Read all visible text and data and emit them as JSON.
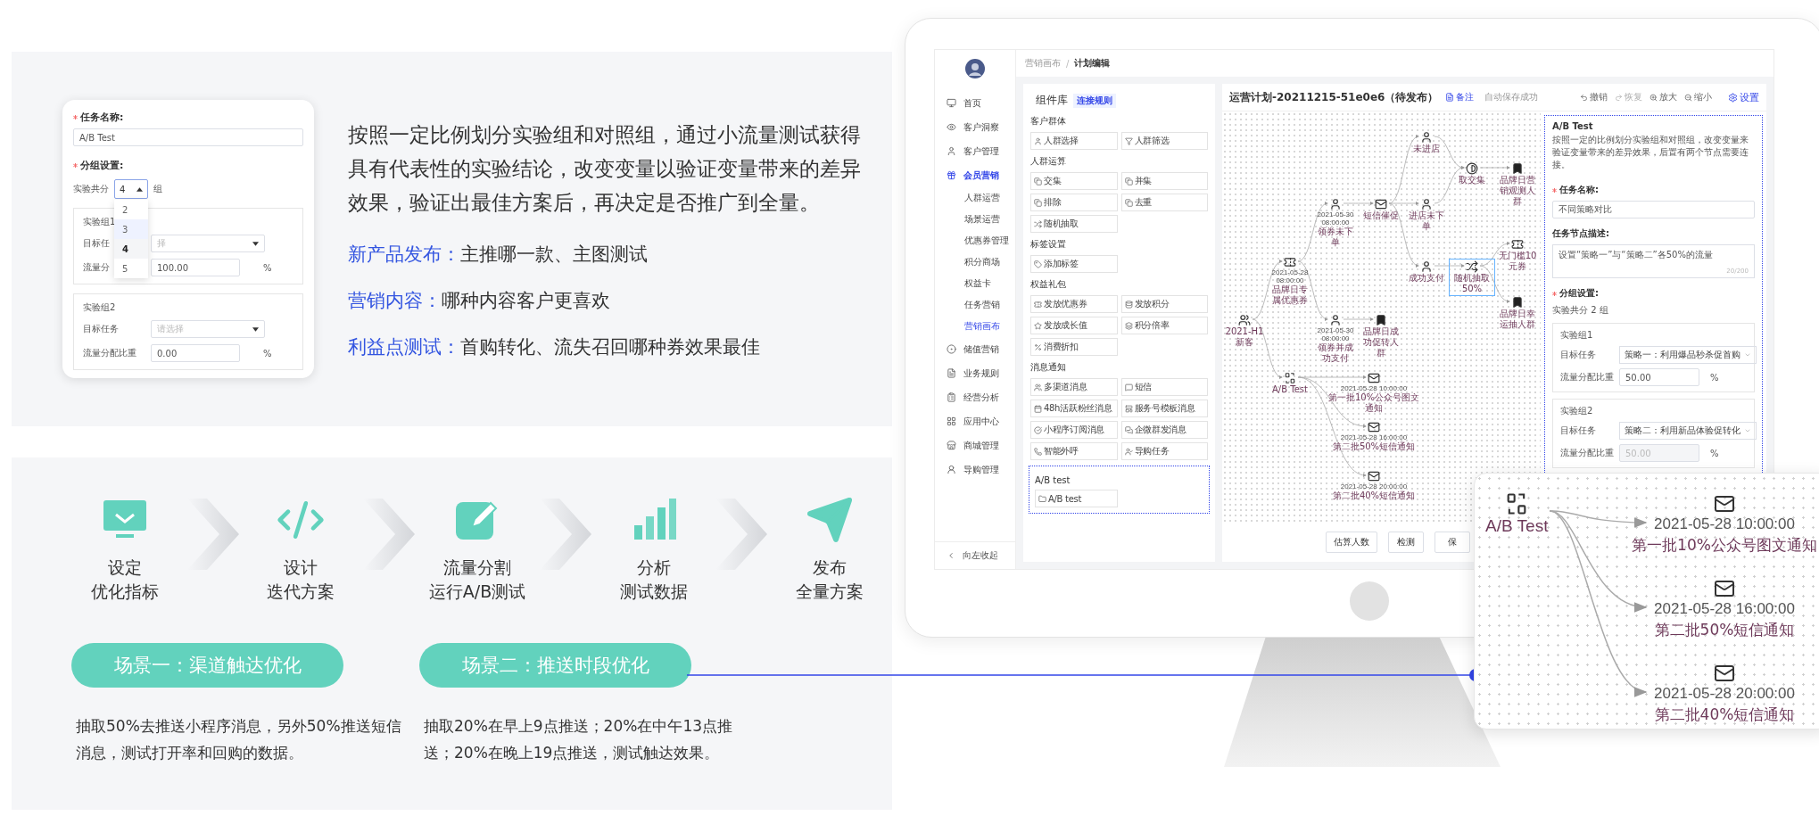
{
  "intro_card": {
    "name_label": "任务名称:",
    "name_required": true,
    "name_value": "A/B Test",
    "group_label": "分组设置:",
    "group_required": true,
    "split_prefix": "实验共分",
    "split_value": "4",
    "split_suffix": "组",
    "dropdown_options": [
      {
        "label": "2",
        "selected": false,
        "hovered": false
      },
      {
        "label": "3",
        "selected": false,
        "hovered": true
      },
      {
        "label": "4",
        "selected": true,
        "hovered": false
      },
      {
        "label": "5",
        "selected": false,
        "hovered": false
      }
    ],
    "groups": [
      {
        "title": "实验组1",
        "target_label": "目标任",
        "target_placeholder": "择",
        "ratio_label": "流量分",
        "ratio_value": "100.00",
        "unit": "%"
      },
      {
        "title": "实验组2",
        "target_label": "目标任务",
        "target_placeholder": "请选择",
        "ratio_label": "流量分配比重",
        "ratio_value": "0.00",
        "unit": "%"
      }
    ]
  },
  "intro_text": {
    "paragraph": "按照一定比例划分实验组和对照组，通过小流量测试获得具有代表性的实验结论，改变变量以验证变量带来的差异效果，验证出最佳方案后，再决定是否推广到全量。",
    "features": [
      {
        "label": "新产品发布：",
        "text": "主推哪一款、主图测试"
      },
      {
        "label": "营销内容：",
        "text": "哪种内容客户更喜欢"
      },
      {
        "label": "利益点测试：",
        "text": "首购转化、流失召回哪种券效果最佳"
      }
    ]
  },
  "steps": [
    {
      "lines": [
        "设定",
        "优化指标"
      ]
    },
    {
      "lines": [
        "设计",
        "迭代方案"
      ]
    },
    {
      "lines": [
        "流量分割",
        "运行A/B测试"
      ]
    },
    {
      "lines": [
        "分析",
        "测试数据"
      ]
    },
    {
      "lines": [
        "发布",
        "全量方案"
      ]
    }
  ],
  "scenarios": [
    {
      "title": "场景一：渠道触达优化",
      "desc": "抽取50%去推送小程序消息，另外50%推送短信消息，测试打开率和回购的数据。"
    },
    {
      "title": "场景二：推送时段优化",
      "desc": "抽取20%在早上9点推送；20%在中午13点推送；20%在晚上19点推送，测试触达效果。"
    }
  ],
  "app": {
    "breadcrumb": [
      "营销画布",
      "计划编辑"
    ],
    "breadcrumb_separator": "/",
    "sidebar": {
      "items": [
        {
          "label": "首页",
          "selected": false
        },
        {
          "label": "客户洞察",
          "selected": false
        },
        {
          "label": "客户管理",
          "selected": false
        },
        {
          "label": "会员营销",
          "selected": true,
          "children": [
            {
              "label": "人群运营",
              "selected": false
            },
            {
              "label": "场景运营",
              "selected": false
            },
            {
              "label": "优惠券管理",
              "selected": false
            },
            {
              "label": "积分商场",
              "selected": false
            },
            {
              "label": "权益卡",
              "selected": false
            },
            {
              "label": "任务营销",
              "selected": false
            },
            {
              "label": "营销画布",
              "selected": true
            }
          ]
        },
        {
          "label": "储值营销",
          "selected": false
        },
        {
          "label": "业务规则",
          "selected": false
        },
        {
          "label": "经营分析",
          "selected": false
        },
        {
          "label": "应用中心",
          "selected": false
        },
        {
          "label": "商城管理",
          "selected": false
        },
        {
          "label": "导购管理",
          "selected": false
        }
      ],
      "collapse": "向左收起"
    },
    "library": {
      "title": "组件库",
      "tag": "连接规则",
      "sections": [
        {
          "title": "客户群体",
          "highlighted": false,
          "items": [
            "人群选择",
            "人群筛选"
          ]
        },
        {
          "title": "人群运算",
          "highlighted": false,
          "items": [
            "交集",
            "并集",
            "排除",
            "去重",
            "随机抽取"
          ]
        },
        {
          "title": "标签设置",
          "highlighted": false,
          "items": [
            "添加标签"
          ]
        },
        {
          "title": "权益礼包",
          "highlighted": false,
          "items": [
            "发放优惠券",
            "发放积分",
            "发放成长值",
            "积分倍率",
            "消费折扣"
          ]
        },
        {
          "title": "消息通知",
          "highlighted": false,
          "items": [
            "多渠道消息",
            "短信",
            "48h活跃粉丝消息",
            "服务号模板消息",
            "小程序订阅消息",
            "企微群发消息",
            "智能外呼",
            "导购任务"
          ]
        },
        {
          "title": "A/B test",
          "highlighted": true,
          "items": [
            "A/B test"
          ]
        }
      ]
    },
    "plan": {
      "title": "运营计划-20211215-51e0e6（待发布）",
      "note": "备注",
      "save_status": "自动保存成功",
      "tools": [
        {
          "label": "撤销",
          "disabled": false
        },
        {
          "label": "恢复",
          "disabled": true
        },
        {
          "label": "放大",
          "disabled": false
        },
        {
          "label": "缩小",
          "disabled": false
        }
      ],
      "settings": "设置"
    },
    "flow": {
      "nodes": [
        {
          "label": "2021-H1新客",
          "selected": false
        },
        {
          "date": "2021-05-28 08:00:00",
          "label": "品牌日专属优惠券",
          "selected": false
        },
        {
          "label": "A/B Test",
          "selected": false
        },
        {
          "date": "2021-05-30 08:00:00",
          "label": "领券未下单",
          "selected": false
        },
        {
          "date": "2021-05-30 08:00:00",
          "label": "领券并成功支付",
          "selected": false
        },
        {
          "label": "短信催促",
          "selected": false
        },
        {
          "label": "品牌日成功促转人群",
          "selected": false
        },
        {
          "label": "未进店",
          "selected": false
        },
        {
          "label": "进店未下单",
          "selected": false
        },
        {
          "label": "成功支付",
          "selected": false
        },
        {
          "label": "取交集",
          "selected": false
        },
        {
          "label": "随机抽取50%",
          "selected": true
        },
        {
          "label": "品牌日营销观测人群",
          "selected": false
        },
        {
          "label": "无门槛10元券",
          "selected": false
        },
        {
          "label": "品牌日幸运抽人群",
          "selected": false
        },
        {
          "date": "2021-05-28 10:00:00",
          "label": "第一批10%公众号图文通知",
          "selected": false
        },
        {
          "date": "2021-05-28 16:00:00",
          "label": "第二批50%短信通知",
          "selected": false
        },
        {
          "date": "2021-05-28 20:00:00",
          "label": "第二批40%短信通知",
          "selected": false
        }
      ]
    },
    "actions": [
      "估算人数",
      "检测",
      "保"
    ],
    "properties": {
      "title": "A/B Test",
      "description": "按照一定的比例划分实验组和对照组，改变变量来验证变量带来的差异效果，后置有两个节点需要连接。",
      "name_label": "任务名称:",
      "name_required": true,
      "name_value": "不同策略对比",
      "desc_label": "任务节点描述:",
      "desc_value": "设置“策略一”与“策略二”各50%的流量",
      "counter": "20/200",
      "group_label": "分组设置:",
      "group_required": true,
      "split": "实验共分 2 组",
      "groups": [
        {
          "title": "实验组1",
          "target_label": "目标任务",
          "target_value": "策略一：利用爆品秒杀促首购",
          "ratio_label": "流量分配比重",
          "ratio_value": "50.00",
          "unit": "%",
          "disabled": false
        },
        {
          "title": "实验组2",
          "target_label": "目标任务",
          "target_value": "策略二：利用新品体验促转化",
          "ratio_label": "流量分配比重",
          "ratio_value": "50.00",
          "unit": "%",
          "disabled": true
        }
      ]
    }
  },
  "callout": {
    "source": "A/B Test",
    "messages": [
      {
        "date": "2021-05-28 10:00:00",
        "label": "第一批10%公众号图文通知"
      },
      {
        "date": "2021-05-28 16:00:00",
        "label": "第二批50%短信通知"
      },
      {
        "date": "2021-05-28 20:00:00",
        "label": "第二批40%短信通知"
      }
    ]
  }
}
